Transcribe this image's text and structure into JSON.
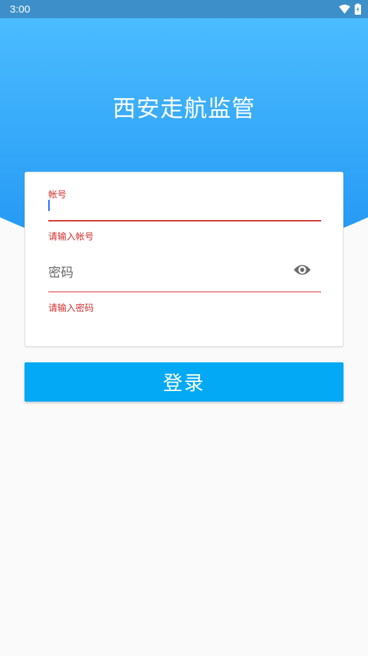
{
  "status_bar": {
    "time": "3:00",
    "icons": [
      "wifi-icon",
      "battery-charging-icon"
    ]
  },
  "header": {
    "title": "西安走航监管"
  },
  "form": {
    "account": {
      "label": "帐号",
      "value": "",
      "error": "请输入帐号"
    },
    "password": {
      "placeholder": "密码",
      "value": "",
      "error": "请输入密码",
      "toggle_icon": "eye-icon"
    }
  },
  "login_button": {
    "label": "登录"
  },
  "colors": {
    "status_bar": "#3c8fc9",
    "header_top": "#4bbcff",
    "header_bottom": "#2196f3",
    "primary_button": "#03a9f4",
    "error": "#d32f2f",
    "cursor": "#1e66ff",
    "background": "#fafafa"
  }
}
